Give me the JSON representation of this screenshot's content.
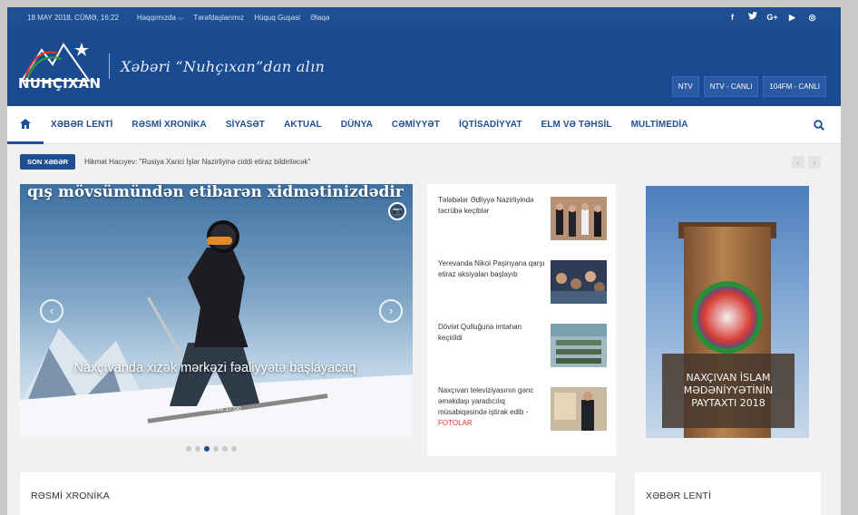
{
  "topbar": {
    "date": "18 MAY 2018, CÜMƏ, 16:22",
    "links": [
      "Haqqımızda ⌵",
      "Tərəfdaşlarımız",
      "Hüquq Guşəsi",
      "Əlaqə"
    ],
    "social": [
      "f",
      "t",
      "G+",
      "▶",
      "◎"
    ]
  },
  "header": {
    "logo_text": "NUHÇIXAN",
    "slogan": "Xəbəri “Nuhçıxan”dan alın",
    "live_buttons": [
      "NTV",
      "NTV - CANLI",
      "104FM - CANLI"
    ]
  },
  "nav": {
    "items": [
      "XƏBƏR LENTİ",
      "RƏSMİ XRONİKA",
      "SİYASƏT",
      "AKTUAL",
      "DÜNYA",
      "CƏMİYYƏT",
      "İQTİSADİYYAT",
      "ELM VƏ TƏHSİL",
      "MULTİMEDİA"
    ]
  },
  "ticker": {
    "badge": "SON XƏBƏR",
    "text": "Hikmət Hacıyev: \"Rusiya Xarici İşlər Nazirliyinə ciddi etiraz bildiriləcək\""
  },
  "slider": {
    "top_text": "qış mövsümündən etibarən xidmətinizdədir",
    "caption": "Naxçıvanda xizək mərkəzi fəaliyyətə başlayacaq",
    "date": "17.05.2018 17:00",
    "dots": 6,
    "active_dot": 2
  },
  "news": [
    {
      "title": "Tələbələr Ədliyyə Nazirliyində təcrübə keçiblər",
      "extra": ""
    },
    {
      "title": "Yerevanda Nikol Paşinyana qarşı etiraz aksiyaları başlayıb",
      "extra": ""
    },
    {
      "title": "Dövlət Qulluğuna imtahan keçirildi",
      "extra": ""
    },
    {
      "title": "Naxçıvan televiziyasının gənc əməkdaşı yaradıcılıq müsabiqəsində iştirak edib - ",
      "extra": "FOTOLAR"
    }
  ],
  "banner": {
    "label": "NAXÇIVAN İSLAM MƏDƏNİYYƏTİNİN PAYTAXTI 2018"
  },
  "sections": {
    "left": "RƏSMİ XRONİKA",
    "right": "XƏBƏR LENTİ"
  }
}
